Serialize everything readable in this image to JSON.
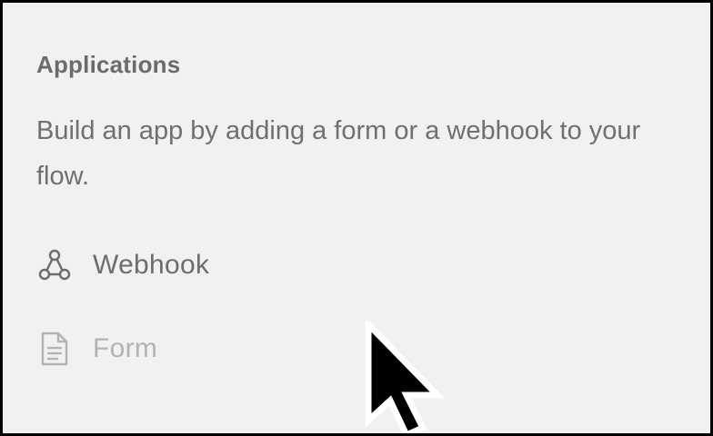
{
  "applications": {
    "title": "Applications",
    "description": "Build an app by adding a form or a webhook to your flow.",
    "items": [
      {
        "label": "Webhook",
        "icon": "webhook-icon",
        "enabled": true
      },
      {
        "label": "Form",
        "icon": "document-icon",
        "enabled": false
      }
    ]
  },
  "colors": {
    "panel_background": "#f1f1f1",
    "text_primary": "#6d6d6d",
    "text_disabled": "#b3b3b3",
    "frame_border": "#000000"
  },
  "cursor": {
    "icon": "mouse-pointer-icon"
  }
}
